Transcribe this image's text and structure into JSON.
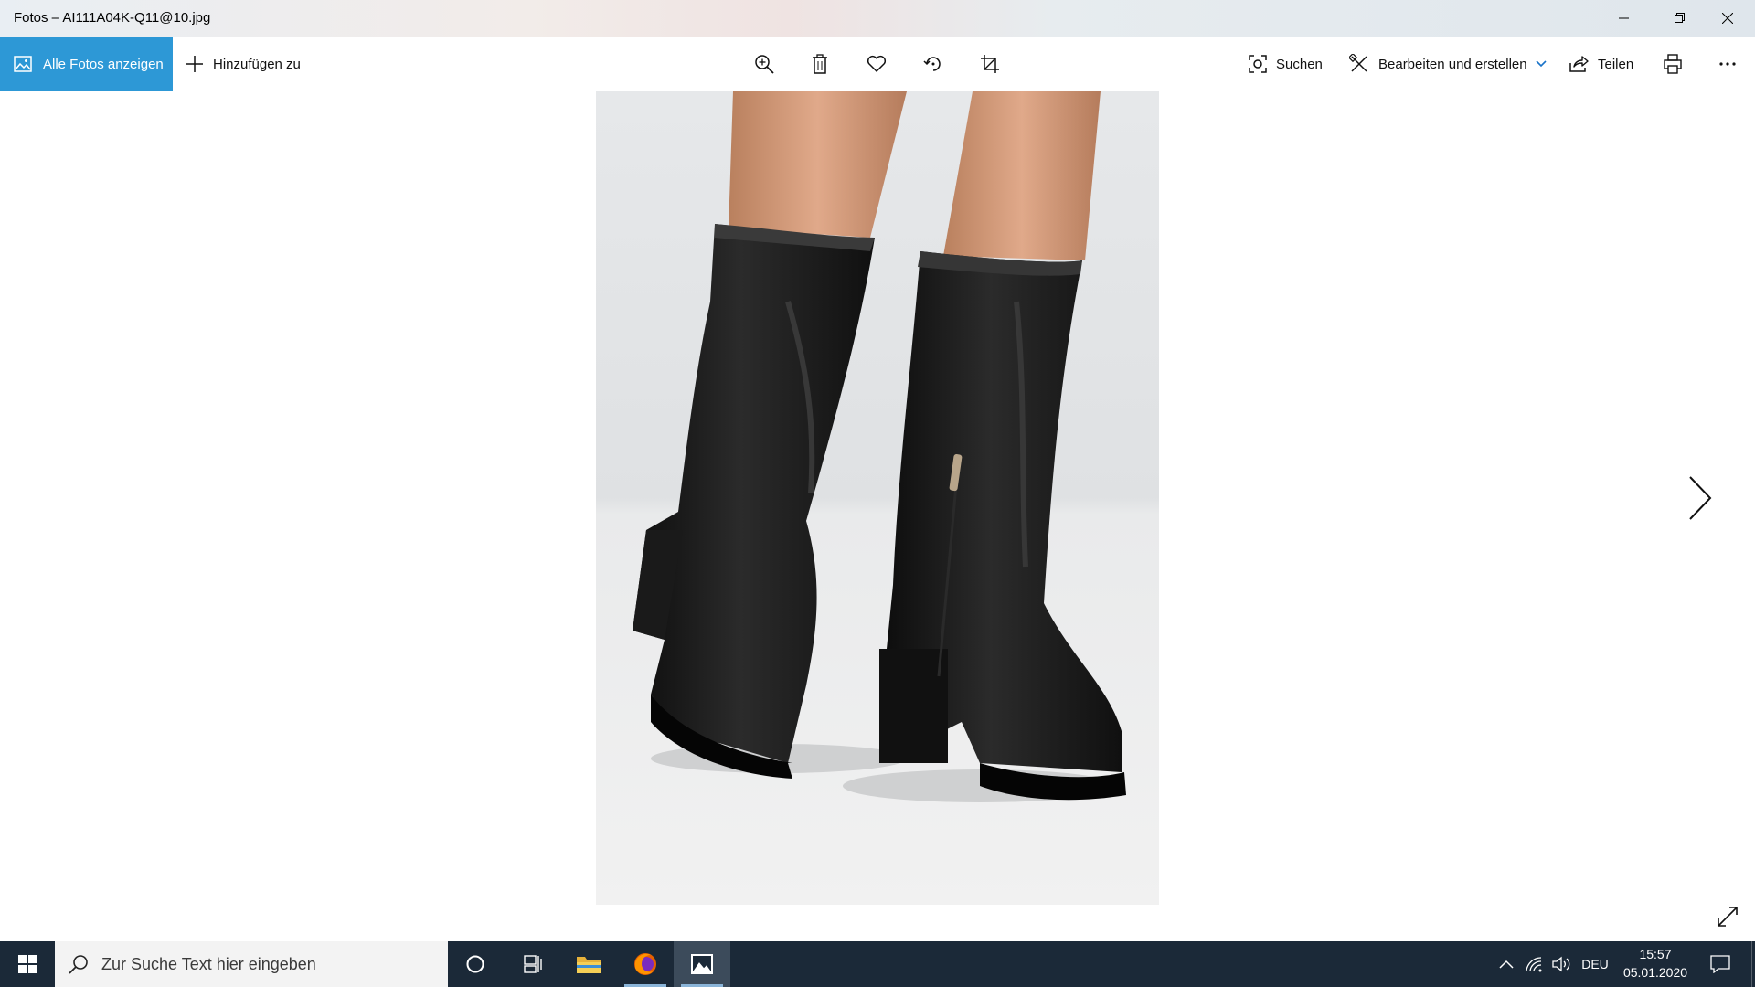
{
  "window": {
    "title": "Fotos – AI111A04K-Q11@10.jpg",
    "controls": [
      "minimize-icon",
      "restore-icon",
      "close-icon"
    ]
  },
  "toolbar": {
    "all_photos_label": "Alle Fotos anzeigen",
    "add_to_label": "Hinzufügen zu",
    "search_label": "Suchen",
    "edit_create_label": "Bearbeiten und erstellen",
    "share_label": "Teilen",
    "center_icons": [
      "zoom-in-icon",
      "delete-icon",
      "favorite-icon",
      "rotate-icon",
      "crop-icon"
    ],
    "accent_color": "#2d98d6"
  },
  "viewer": {
    "image_description_icon": "photo-of-black-leather-high-heel-boots",
    "next_icon": "chevron-right-icon",
    "fullscreen_icon": "expand-icon"
  },
  "taskbar": {
    "search_placeholder": "Zur Suche Text hier eingeben",
    "apps": [
      "cortana-icon",
      "task-view-icon",
      "file-explorer-icon",
      "firefox-icon",
      "photos-app-icon"
    ],
    "language": "DEU",
    "time": "15:57",
    "date": "05.01.2020",
    "background_color": "#1b2938"
  }
}
